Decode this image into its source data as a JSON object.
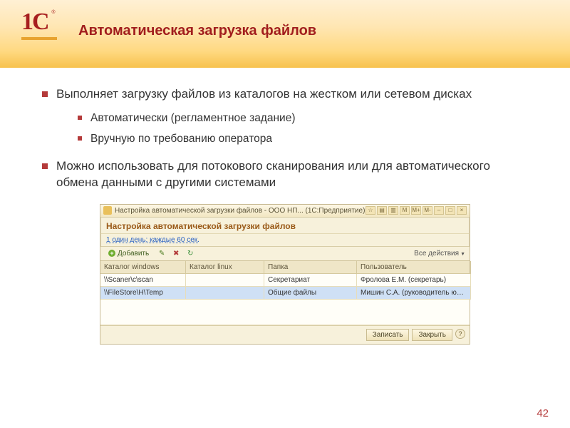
{
  "title": "Автоматическая загрузка файлов",
  "logo": "1С",
  "bullets": {
    "b1": "Выполняет загрузку файлов из каталогов на жестком или сетевом дисках",
    "b1a": "Автоматически (регламентное задание)",
    "b1b": "Вручную по требованию оператора",
    "b2": "Можно использовать для потокового сканирования или для автоматического обмена данными с другими системами"
  },
  "app": {
    "windowTitle": "Настройка автоматической загрузки файлов - ООО НП... (1С:Предприятие)",
    "subtitle": "Настройка автоматической загрузки файлов",
    "schedule": "1 один день; каждые 60 сек.",
    "addLabel": "Добавить",
    "allActions": "Все действия",
    "columns": {
      "c1": "Каталог windows",
      "c2": "Каталог linux",
      "c3": "Папка",
      "c4": "Пользователь"
    },
    "rows": [
      {
        "c1": "\\\\Scaner\\c\\scan",
        "c2": "",
        "c3": "Секретариат",
        "c4": "Фролова Е.М. (секретарь)"
      },
      {
        "c1": "\\\\FileStore\\H\\Temp",
        "c2": "",
        "c3": "Общие файлы",
        "c4": "Мишин С.А. (руководитель юрид..."
      }
    ],
    "saveLabel": "Записать",
    "closeLabel": "Закрыть"
  },
  "pageNumber": "42"
}
